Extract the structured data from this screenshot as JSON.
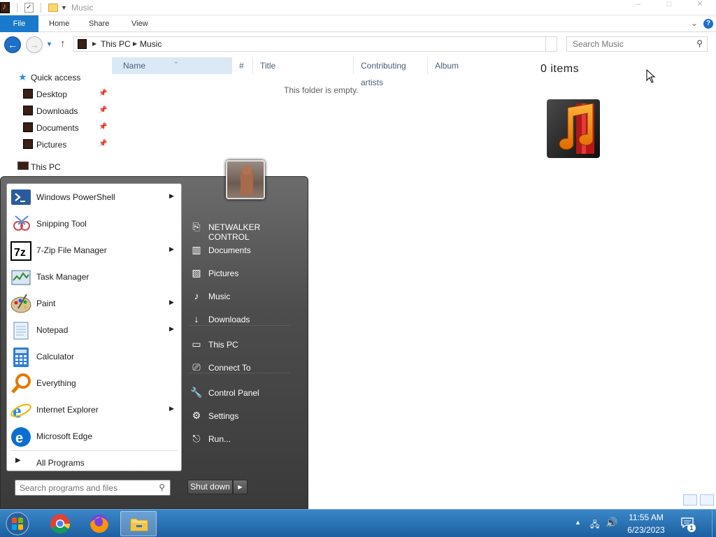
{
  "window": {
    "title": "Music",
    "controls": {
      "minimize": "–",
      "maximize": "□",
      "close": "✕"
    }
  },
  "ribbon": {
    "tabs": [
      "File",
      "Home",
      "Share",
      "View"
    ],
    "help": "?"
  },
  "address": {
    "crumbs": [
      "This PC",
      "Music"
    ],
    "search_placeholder": "Search Music"
  },
  "nav_pane": {
    "quick_access": "Quick access",
    "items": [
      {
        "label": "Desktop",
        "pinned": true
      },
      {
        "label": "Downloads",
        "pinned": true
      },
      {
        "label": "Documents",
        "pinned": true
      },
      {
        "label": "Pictures",
        "pinned": true
      }
    ],
    "this_pc": "This PC"
  },
  "file_list": {
    "columns": [
      "Name",
      "#",
      "Title",
      "Contributing artists",
      "Album"
    ],
    "empty_message": "This folder is empty."
  },
  "details_pane": {
    "item_count": "0 items"
  },
  "start_menu": {
    "programs": [
      {
        "label": "Windows PowerShell",
        "has_submenu": true,
        "icon": "powershell-icon"
      },
      {
        "label": "Snipping Tool",
        "has_submenu": false,
        "icon": "snipping-tool-icon"
      },
      {
        "label": "7-Zip File Manager",
        "has_submenu": true,
        "icon": "7zip-icon"
      },
      {
        "label": "Task Manager",
        "has_submenu": false,
        "icon": "task-manager-icon"
      },
      {
        "label": "Paint",
        "has_submenu": true,
        "icon": "paint-icon"
      },
      {
        "label": "Notepad",
        "has_submenu": true,
        "icon": "notepad-icon"
      },
      {
        "label": "Calculator",
        "has_submenu": false,
        "icon": "calculator-icon"
      },
      {
        "label": "Everything",
        "has_submenu": false,
        "icon": "everything-icon"
      },
      {
        "label": "Internet Explorer",
        "has_submenu": true,
        "icon": "internet-explorer-icon"
      },
      {
        "label": "Microsoft Edge",
        "has_submenu": false,
        "icon": "edge-icon"
      }
    ],
    "all_programs": "All Programs",
    "search_placeholder": "Search programs and files",
    "right_items": [
      {
        "label": "NETWALKER CONTROL",
        "icon": "user-folder-icon"
      },
      {
        "label": "Documents",
        "icon": "documents-icon"
      },
      {
        "label": "Pictures",
        "icon": "pictures-icon"
      },
      {
        "label": "Music",
        "icon": "music-icon"
      },
      {
        "label": "Downloads",
        "icon": "downloads-icon"
      },
      {
        "label": "This PC",
        "icon": "computer-icon"
      },
      {
        "label": "Connect To",
        "icon": "connect-to-icon"
      },
      {
        "label": "Control Panel",
        "icon": "control-panel-icon"
      },
      {
        "label": "Settings",
        "icon": "settings-gear-icon"
      },
      {
        "label": "Run...",
        "icon": "run-icon"
      }
    ],
    "shutdown": "Shut down"
  },
  "taskbar": {
    "apps": [
      "chrome-icon",
      "firefox-icon",
      "file-explorer-icon"
    ],
    "time": "11:55 AM",
    "date": "6/23/2023",
    "notification_count": "1"
  },
  "colors": {
    "ribbon_file_tab": "#1979ca",
    "taskbar": "#1d5fa0",
    "startmenu_dark": "#3a3a3a",
    "nav_back": "#1d6fc7"
  }
}
